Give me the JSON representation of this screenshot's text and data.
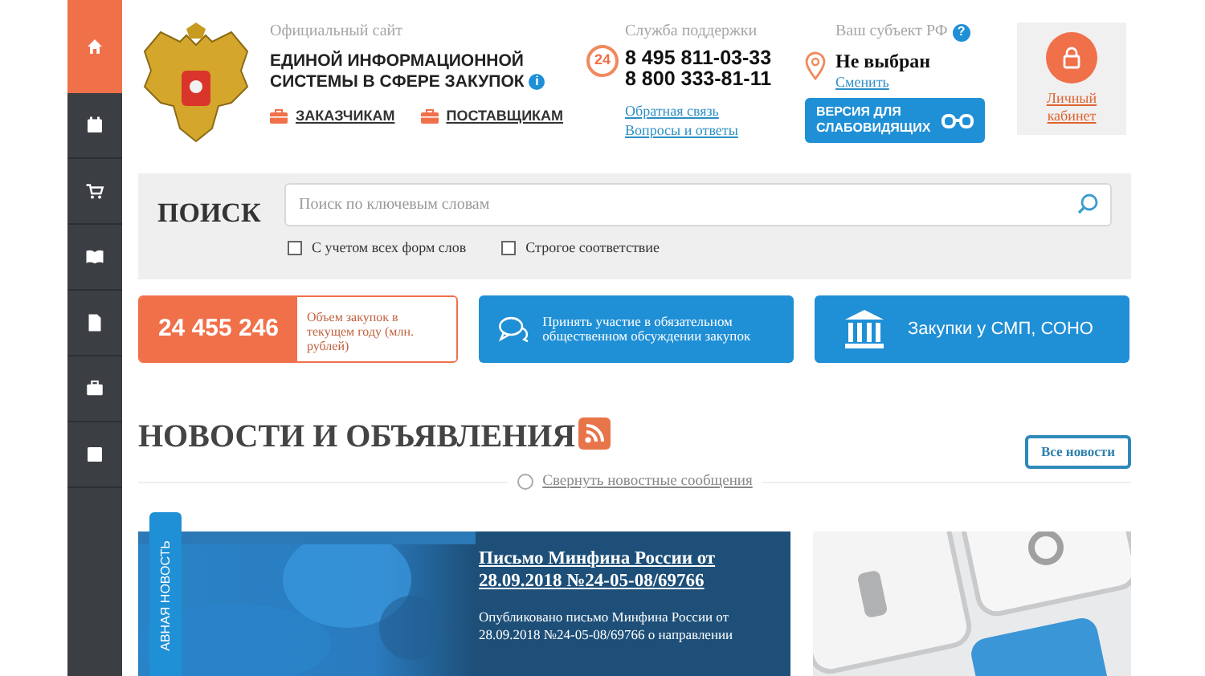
{
  "sidebar": {
    "items": [
      {
        "kind": "home",
        "selected": true
      },
      {
        "kind": "calendar",
        "selected": false
      },
      {
        "kind": "cart",
        "selected": false
      },
      {
        "kind": "book",
        "selected": false
      },
      {
        "kind": "document",
        "selected": false
      },
      {
        "kind": "briefcase",
        "selected": false
      },
      {
        "kind": "list",
        "selected": false
      }
    ]
  },
  "header": {
    "site_label": "Официальный сайт",
    "site_title": "ЕДИНОЙ ИНФОРМАЦИОННОЙ СИСТЕМЫ В СФЕРЕ ЗАКУПОК",
    "links": [
      "ЗАКАЗЧИКАМ",
      "ПОСТАВЩИКАМ"
    ],
    "info_mark": "i",
    "support": {
      "label": "Служба поддержки",
      "badge": "24",
      "phones": [
        "8 495 811-03-33",
        "8 800 333-81-11"
      ],
      "links": [
        "Обратная связь",
        "Вопросы и ответы"
      ]
    },
    "region": {
      "label": "Ваш субъект РФ",
      "help_mark": "?",
      "value": "Не выбран",
      "change_link": "Сменить"
    },
    "accessibility_button": "ВЕРСИЯ ДЛЯ СЛАБОВИДЯЩИХ",
    "cabinet_link": "Личный кабинет"
  },
  "search": {
    "title": "ПОИСК",
    "placeholder": "Поиск по ключевым словам",
    "options": [
      {
        "label": "С учетом всех форм слов",
        "checked": false
      },
      {
        "label": "Строгое соответствие",
        "checked": false
      }
    ]
  },
  "tiles": [
    {
      "kind": "stat",
      "value": "24 455 246",
      "caption": "Объем закупок в текущем году (млн. рублей)"
    },
    {
      "kind": "discussion",
      "caption": "Принять участие в обязательном общественном обсуждении закупок"
    },
    {
      "kind": "institution",
      "caption": "Закупки у СМП, СОНО"
    }
  ],
  "news": {
    "title": "НОВОСТИ И ОБЪЯВЛЕНИЯ",
    "all_button": "Все новости",
    "collapse_link": "Свернуть новостные сообщения",
    "featured": {
      "badge": "АВНАЯ НОВОСТЬ",
      "title": "Письмо Минфина России от 28.09.2018 №24-05-08/69766",
      "excerpt": "Опубликовано письмо Минфина России от 28.09.2018 №24-05-08/69766 о направлении"
    }
  }
}
